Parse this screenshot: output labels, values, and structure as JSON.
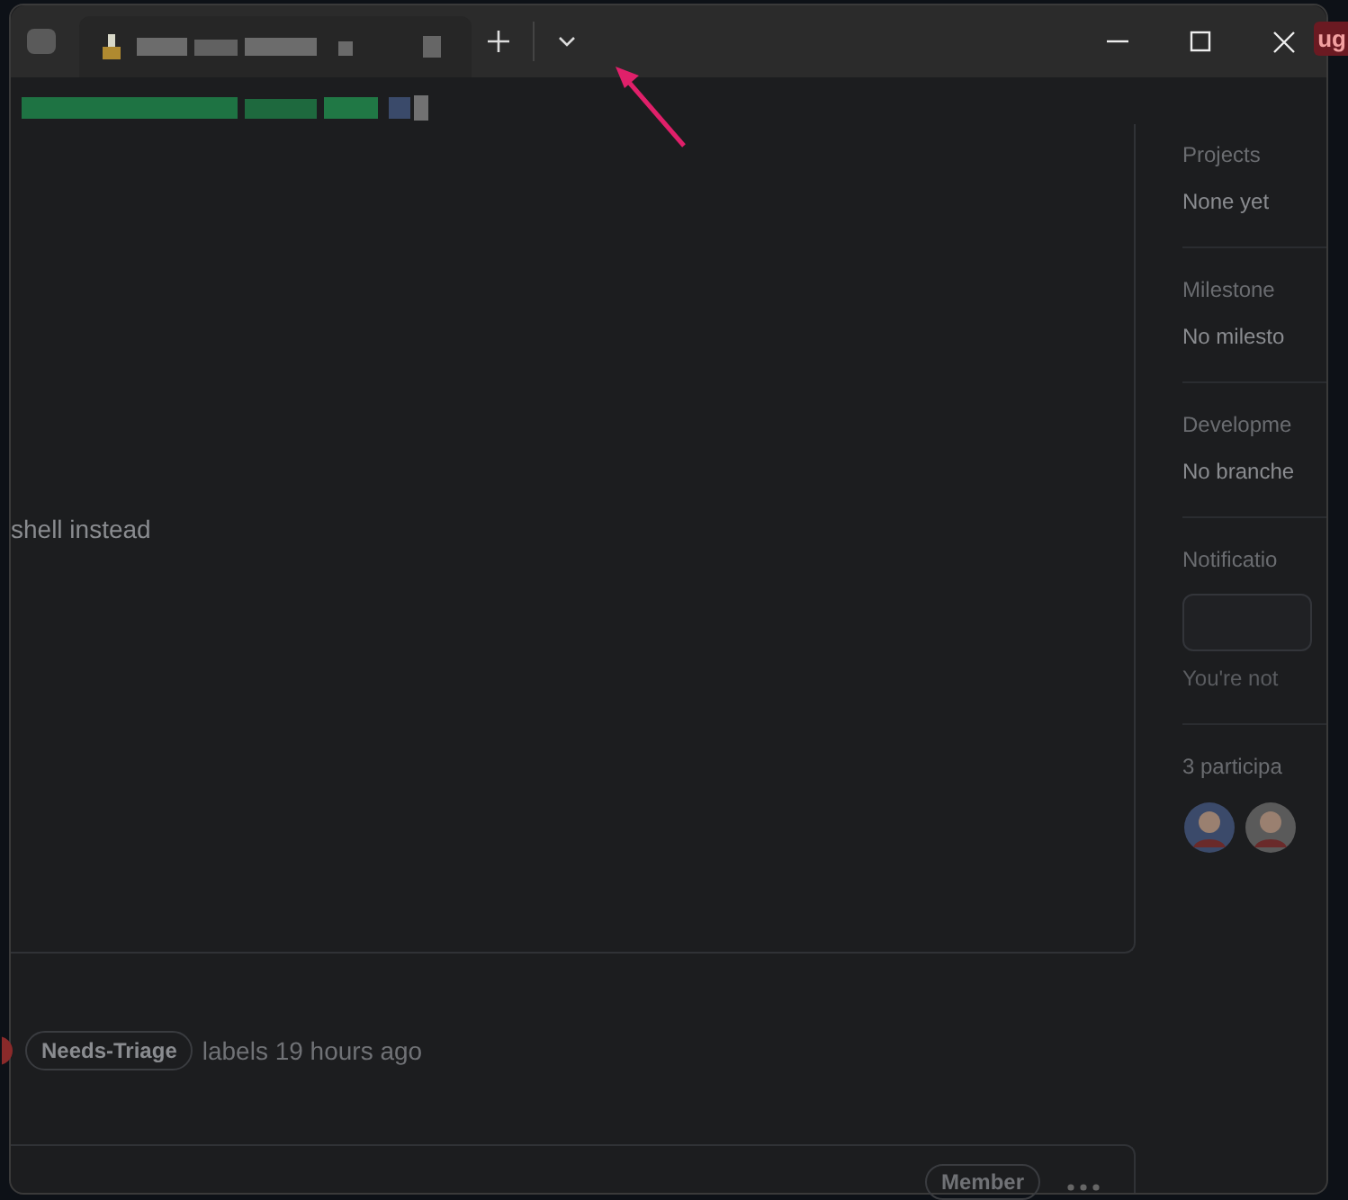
{
  "corner_label": "ug",
  "issue": {
    "body_text": "shell instead",
    "timeline": {
      "label": "Needs-Triage",
      "action": "labels 19 hours ago"
    },
    "comment": {
      "badge": "Member"
    }
  },
  "sidebar": {
    "sections": [
      {
        "kind": "text",
        "heading": "Projects",
        "value": "None yet"
      },
      {
        "kind": "text",
        "heading": "Milestone",
        "value": "No milesto"
      },
      {
        "kind": "text",
        "heading": "Developme",
        "value": "No branche"
      },
      {
        "kind": "button",
        "heading": "Notificatio",
        "note": "You're not"
      },
      {
        "kind": "avatars",
        "heading": "3 participa"
      }
    ]
  }
}
